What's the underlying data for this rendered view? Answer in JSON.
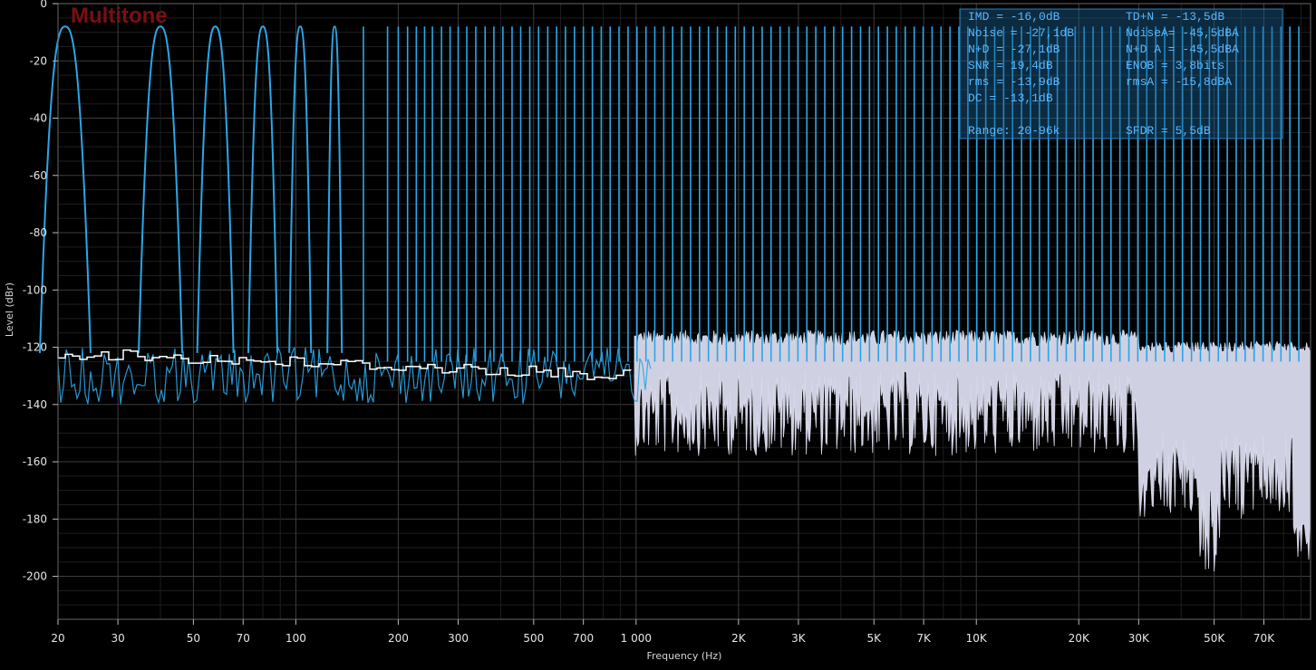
{
  "chart_data": {
    "type": "line",
    "title": "Multitone",
    "xlabel": "Frequency (Hz)",
    "ylabel": "Level (dBr)",
    "xscale": "log",
    "xlim": [
      20,
      96000
    ],
    "ylim": [
      -215,
      0
    ],
    "grid": true,
    "y_ticks": [
      "0",
      "-20",
      "-40",
      "-60",
      "-80",
      "-100",
      "-120",
      "-140",
      "-160",
      "-180",
      "-200"
    ],
    "y_tick_values": [
      0,
      -20,
      -40,
      -60,
      -80,
      -100,
      -120,
      -140,
      -160,
      -180,
      -200
    ],
    "x_ticks": [
      {
        "value": 20,
        "label": "20"
      },
      {
        "value": 30,
        "label": "30"
      },
      {
        "value": 50,
        "label": "50"
      },
      {
        "value": 70,
        "label": "70"
      },
      {
        "value": 100,
        "label": "100"
      },
      {
        "value": 200,
        "label": "200"
      },
      {
        "value": 300,
        "label": "300"
      },
      {
        "value": 500,
        "label": "500"
      },
      {
        "value": 700,
        "label": "700"
      },
      {
        "value": 1000,
        "label": "1 000"
      },
      {
        "value": 2000,
        "label": "2K"
      },
      {
        "value": 3000,
        "label": "3K"
      },
      {
        "value": 5000,
        "label": "5K"
      },
      {
        "value": 7000,
        "label": "7K"
      },
      {
        "value": 10000,
        "label": "10K"
      },
      {
        "value": 20000,
        "label": "20K"
      },
      {
        "value": 30000,
        "label": "30K"
      },
      {
        "value": 50000,
        "label": "50K"
      },
      {
        "value": 70000,
        "label": "70K"
      }
    ],
    "tone_frequencies_hz": [
      21,
      40,
      58,
      80,
      103,
      130,
      158,
      186,
      200,
      213,
      226,
      239,
      252,
      268,
      284,
      300,
      318,
      338,
      360,
      382,
      406,
      432,
      458,
      487,
      517,
      550,
      584,
      620,
      659,
      700,
      744,
      790,
      839,
      891,
      947,
      1006,
      1069,
      1135,
      1206,
      1281,
      1361,
      1446,
      1536,
      1632,
      1734,
      1842,
      1957,
      2079,
      2209,
      2347,
      2493,
      2649,
      2814,
      2990,
      3176,
      3374,
      3585,
      3809,
      4046,
      4299,
      4567,
      4852,
      5155,
      5477,
      5818,
      6181,
      6567,
      6977,
      7412,
      7875,
      8366,
      8888,
      9443,
      10032,
      10658,
      11323,
      12030,
      12780,
      13578,
      14425,
      15325,
      16282,
      17298,
      18377,
      19524,
      20742,
      22037,
      23412,
      24873,
      26425,
      28074,
      29826,
      31687,
      33665,
      35765,
      37997,
      40368,
      42887,
      45563,
      48407,
      51427,
      54636,
      58046,
      61668,
      65516,
      69604,
      73948,
      78562,
      83465,
      88673
    ],
    "tone_level_db": -8,
    "series": [
      {
        "role": "tones",
        "color": "#2aa6e8"
      },
      {
        "role": "noise",
        "color": "#dcdcec"
      },
      {
        "role": "noise-average",
        "color": "#ffffff"
      }
    ],
    "stats": [
      [
        "IMD   = -16,0dB",
        "TD+N  = -13,5dB"
      ],
      [
        "Noise = -27,1dB",
        "NoiseA= -45,5dBA"
      ],
      [
        "N+D   = -27,1dB",
        "N+D A = -45,5dBA"
      ],
      [
        "SNR   =  19,4dB",
        "ENOB  =   3,8bits"
      ],
      [
        "rms   = -13,9dB",
        "rmsA  = -15,8dBA"
      ],
      [
        "DC    = -13,1dB",
        ""
      ],
      [
        "",
        ""
      ],
      [
        "Range:  20-96k",
        "SFDR  =   5,5dB"
      ]
    ],
    "colors": {
      "background": "#000000",
      "grid": "#3c3c3c",
      "title": "#7a0f12",
      "stats_text": "#57b7ff",
      "stats_box": "#1a5f8f"
    }
  }
}
